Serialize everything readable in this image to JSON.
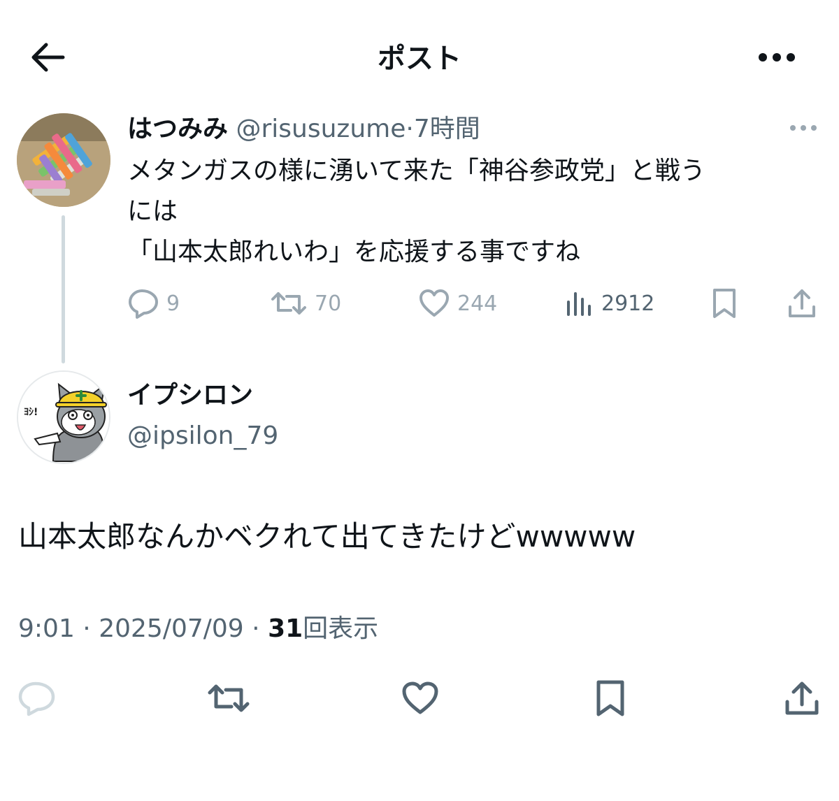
{
  "header": {
    "title": "ポスト"
  },
  "parent_post": {
    "display_name": "はつみみ",
    "handle": "@risusuzume",
    "separator": "·",
    "time": "7時間",
    "text_lines": [
      "メタンガスの様に湧いて来た「神谷参政党」と戦う",
      "には",
      "「山本太郎れいわ」を応援する事ですね"
    ],
    "stats": {
      "replies": "9",
      "reposts": "70",
      "likes": "244",
      "views": "2912"
    }
  },
  "reply_post": {
    "display_name": "イプシロン",
    "handle": "@ipsilon_79",
    "text": "山本太郎なんかベクれて出てきたけどwwwww",
    "time": "9:01",
    "date": "2025/07/09",
    "dot": "·",
    "view_count": "31",
    "view_label": "回表示",
    "avatar_text": "ﾖｼ!"
  },
  "colors": {
    "text_primary": "#0f1419",
    "text_secondary": "#536471",
    "icon_faded": "#9aa7b1",
    "divider": "#cfd9de"
  }
}
